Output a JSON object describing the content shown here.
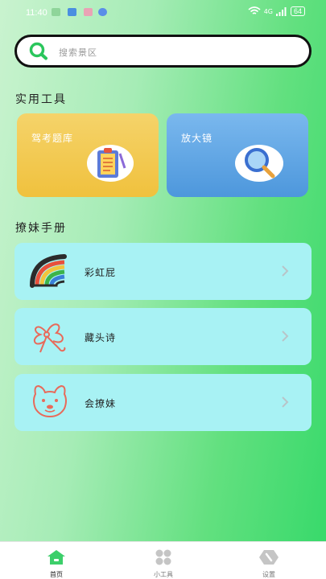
{
  "status_bar": {
    "time": "11:40",
    "network": "4G",
    "battery": "64"
  },
  "search": {
    "placeholder": "搜索景区"
  },
  "tools_section": {
    "title": "实用工具",
    "cards": [
      {
        "label": "驾考题库",
        "icon": "clipboard-icon",
        "color": "#f2c64a"
      },
      {
        "label": "放大镜",
        "icon": "magnifier-icon",
        "color": "#5ea5e4"
      }
    ]
  },
  "manual_section": {
    "title": "撩妹手册",
    "items": [
      {
        "label": "彩虹屁",
        "icon": "rainbow-icon"
      },
      {
        "label": "藏头诗",
        "icon": "flower-icon"
      },
      {
        "label": "会撩妹",
        "icon": "dog-face-icon"
      }
    ]
  },
  "tabbar": {
    "tabs": [
      {
        "label": "首页",
        "icon": "home-icon",
        "active": true,
        "active_color": "#3ccf6a"
      },
      {
        "label": "小工具",
        "icon": "grid-icon",
        "active": false
      },
      {
        "label": "设置",
        "icon": "settings-icon",
        "active": false
      }
    ]
  }
}
